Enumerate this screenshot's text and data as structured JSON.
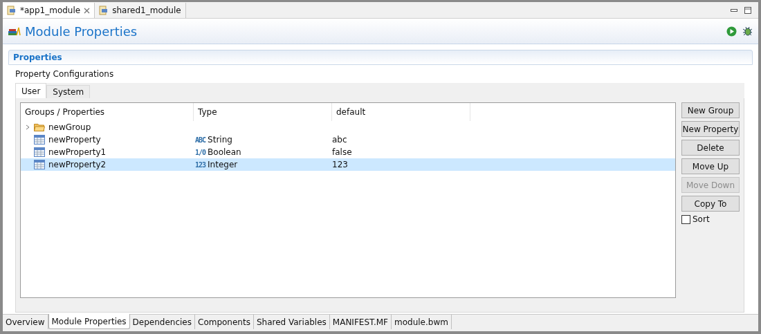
{
  "editor_tabs": [
    {
      "label": "*app1_module",
      "selected": true,
      "closable": true
    },
    {
      "label": "shared1_module",
      "selected": false,
      "closable": false
    }
  ],
  "header": {
    "title": "Module Properties"
  },
  "section": {
    "title": "Properties",
    "subtitle": "Property Configurations"
  },
  "inner_tabs": [
    {
      "label": "User",
      "selected": true
    },
    {
      "label": "System",
      "selected": false
    }
  ],
  "table": {
    "columns": [
      "Groups / Properties",
      "Type",
      "default"
    ],
    "rows": [
      {
        "kind": "group",
        "name": "newGroup",
        "expanded": false,
        "selected": false
      },
      {
        "kind": "property",
        "name": "newProperty",
        "type_icon": "ABC",
        "type": "String",
        "default": "abc",
        "selected": false
      },
      {
        "kind": "property",
        "name": "newProperty1",
        "type_icon": "1/0",
        "type": "Boolean",
        "default": "false",
        "selected": false
      },
      {
        "kind": "property",
        "name": "newProperty2",
        "type_icon": "123",
        "type": "Integer",
        "default": "123",
        "selected": true
      }
    ]
  },
  "buttons": [
    {
      "label": "New Group",
      "disabled": false
    },
    {
      "label": "New Property",
      "disabled": false
    },
    {
      "label": "Delete",
      "disabled": false
    },
    {
      "label": "Move Up",
      "disabled": false
    },
    {
      "label": "Move Down",
      "disabled": true
    },
    {
      "label": "Copy To",
      "disabled": false
    }
  ],
  "sort": {
    "label": "Sort",
    "checked": false
  },
  "page_tabs": [
    {
      "label": "Overview",
      "selected": false
    },
    {
      "label": "Module Properties",
      "selected": true
    },
    {
      "label": "Dependencies",
      "selected": false
    },
    {
      "label": "Components",
      "selected": false
    },
    {
      "label": "Shared Variables",
      "selected": false
    },
    {
      "label": "MANIFEST.MF",
      "selected": false
    },
    {
      "label": "module.bwm",
      "selected": false
    }
  ]
}
